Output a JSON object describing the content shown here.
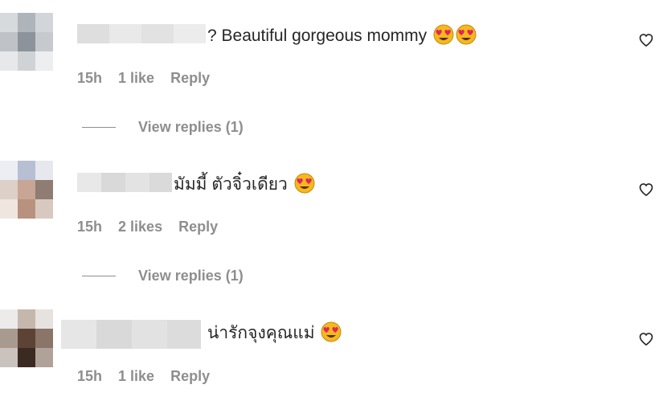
{
  "comments": [
    {
      "text": "? Beautiful gorgeous mommy",
      "emojis": [
        "heart-eyes-emoji",
        "heart-eyes-emoji"
      ],
      "time": "15h",
      "likes": "1 like",
      "reply": "Reply",
      "view_replies": "View replies (1)"
    },
    {
      "text": "มัมมี้ ตัวจิ๋วเดียว",
      "emojis": [
        "heart-eyes-emoji"
      ],
      "time": "15h",
      "likes": "2 likes",
      "reply": "Reply",
      "view_replies": "View replies (1)"
    },
    {
      "text": "น่ารักจุงคุณแม่",
      "emojis": [
        "heart-eyes-emoji"
      ],
      "time": "15h",
      "likes": "1 like",
      "reply": "Reply"
    }
  ],
  "icons": {
    "like": "heart-outline-icon"
  },
  "colors": {
    "text": "#262626",
    "muted": "#8e8e8e",
    "emoji_face": "#f5b81d",
    "emoji_heart": "#e0245e"
  }
}
